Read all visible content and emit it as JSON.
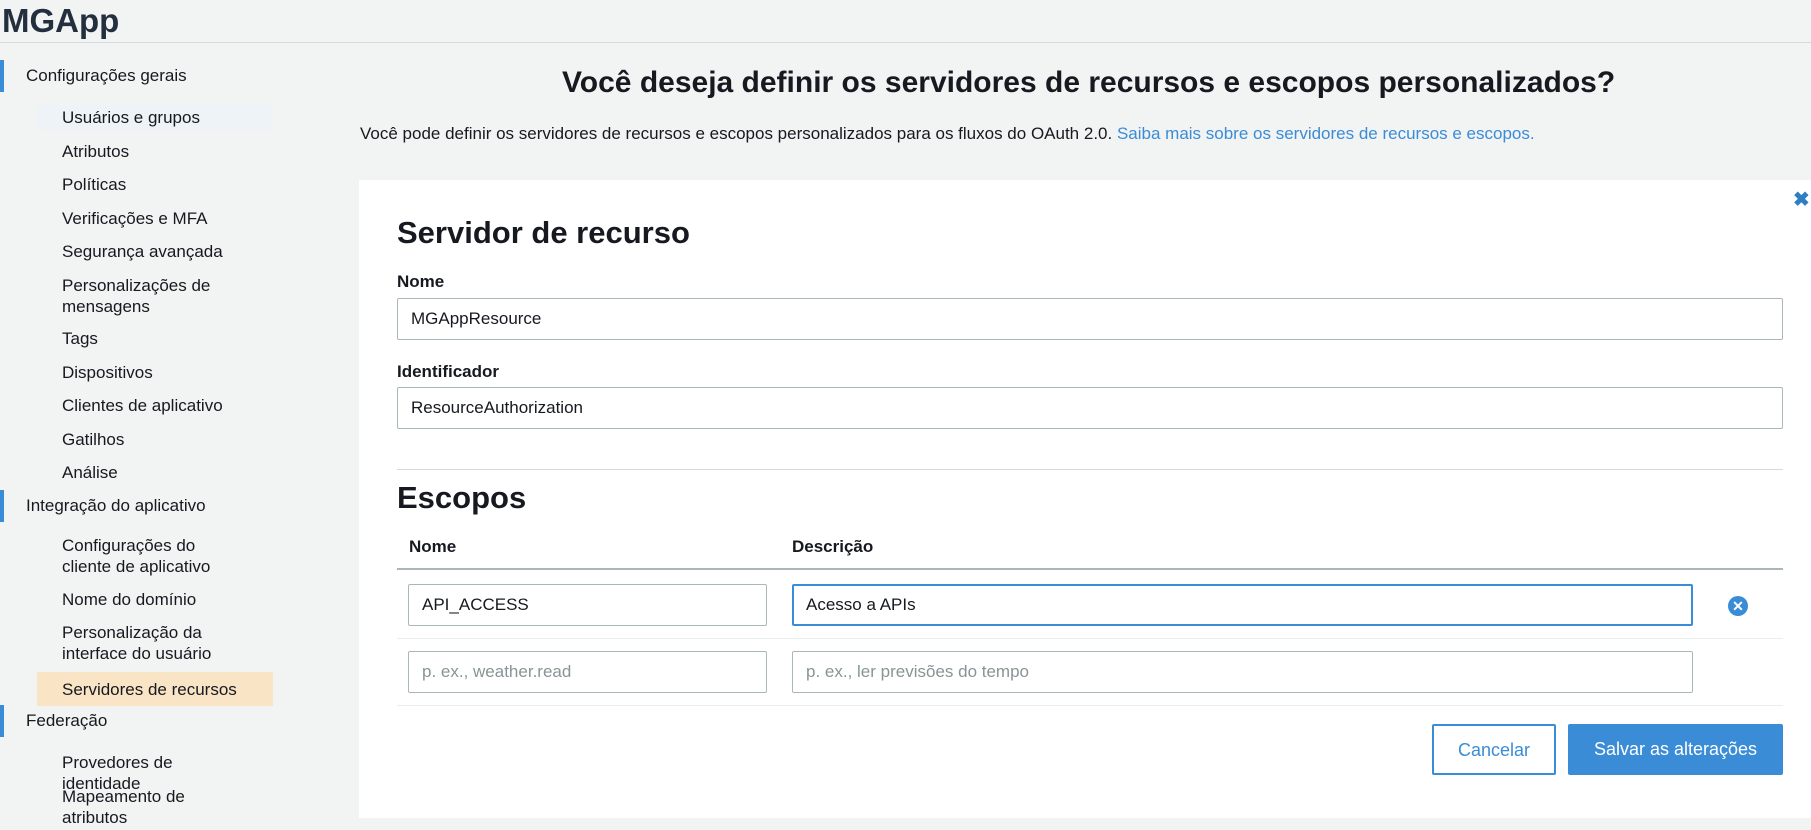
{
  "app": {
    "title": "MGApp"
  },
  "sidebar": {
    "sections": [
      {
        "label": "Configurações gerais"
      },
      {
        "label": "Integração do aplicativo"
      },
      {
        "label": "Federação"
      }
    ],
    "items": [
      {
        "label": "Usuários e grupos"
      },
      {
        "label": "Atributos"
      },
      {
        "label": "Políticas"
      },
      {
        "label": "Verificações e MFA"
      },
      {
        "label": "Segurança avançada"
      },
      {
        "label": "Personalizações de mensagens"
      },
      {
        "label": "Tags"
      },
      {
        "label": "Dispositivos"
      },
      {
        "label": "Clientes de aplicativo"
      },
      {
        "label": "Gatilhos"
      },
      {
        "label": "Análise"
      },
      {
        "label": "Configurações do cliente de aplicativo"
      },
      {
        "label": "Nome do domínio"
      },
      {
        "label": "Personalização da interface do usuário"
      },
      {
        "label": "Servidores de recursos"
      },
      {
        "label": "Provedores de identidade"
      },
      {
        "label": "Mapeamento de atributos"
      }
    ]
  },
  "main": {
    "title": "Você deseja definir os servidores de recursos e escopos personalizados?",
    "description": "Você pode definir os servidores de recursos e escopos personalizados para os fluxos do OAuth 2.0. ",
    "learn_more_link": "Saiba mais sobre os servidores de recursos e escopos."
  },
  "resource_server": {
    "title": "Servidor de recurso",
    "name_label": "Nome",
    "name_value": "MGAppResource",
    "identifier_label": "Identificador",
    "identifier_value": "ResourceAuthorization"
  },
  "scopes": {
    "title": "Escopos",
    "col_name": "Nome",
    "col_description": "Descrição",
    "rows": [
      {
        "name": "API_ACCESS",
        "description": "Acesso a APIs"
      }
    ],
    "new_row": {
      "name_placeholder": "p. ex., weather.read",
      "description_placeholder": "p. ex., ler previsões do tempo"
    }
  },
  "actions": {
    "cancel_label": "Cancelar",
    "save_label": "Salvar as alterações"
  },
  "icons": {
    "close": "close-icon",
    "remove": "remove-circle-icon"
  },
  "colors": {
    "accent": "#3a8cd6",
    "active_nav": "#fae4c6"
  }
}
